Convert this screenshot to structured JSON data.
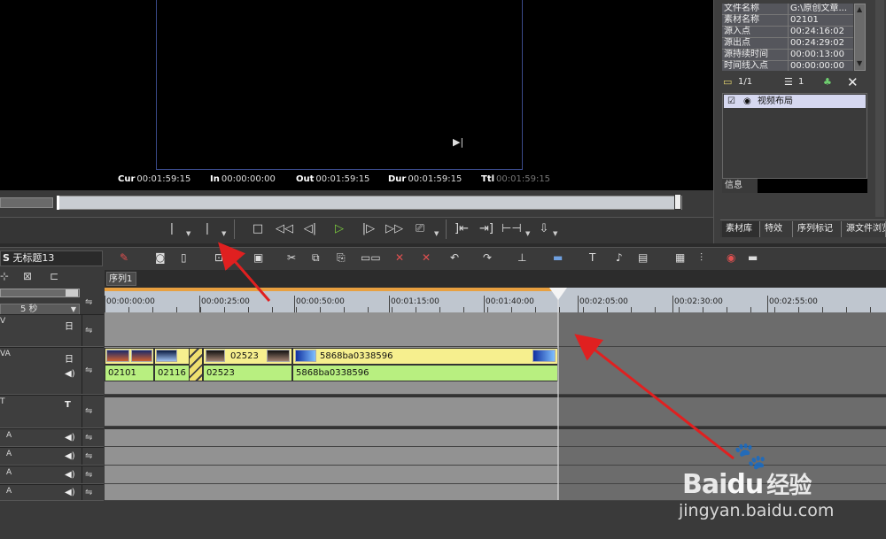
{
  "preview": {
    "timecodes": [
      {
        "label": "Cur",
        "value": "00:01:59:15"
      },
      {
        "label": "In",
        "value": "00:00:00:00"
      },
      {
        "label": "Out",
        "value": "00:01:59:15"
      },
      {
        "label": "Dur",
        "value": "00:01:59:15"
      },
      {
        "label": "Ttl",
        "value": "00:01:59:15"
      }
    ],
    "play_glyph": "▶|"
  },
  "transport_icons": [
    "mark-in-icon",
    "mark-out-icon",
    "stop-icon",
    "rewind-icon",
    "step-back-icon",
    "play-icon",
    "step-forward-icon",
    "fast-forward-icon",
    "loop-icon",
    "go-in-icon",
    "go-out-icon",
    "split-icon",
    "insert-icon"
  ],
  "properties": {
    "rows": [
      {
        "key": "文件名称",
        "value": "G:\\原创文章..."
      },
      {
        "key": "素材名称",
        "value": "02101"
      },
      {
        "key": "源入点",
        "value": "00:24:16:02"
      },
      {
        "key": "源出点",
        "value": "00:24:29:02"
      },
      {
        "key": "源持续时间",
        "value": "00:00:13:00"
      },
      {
        "key": "时间线入点",
        "value": "00:00:00:00"
      }
    ]
  },
  "right_panel": {
    "page": "1/1",
    "count": "1",
    "list_item": "视频布局",
    "info_tab": "信息",
    "tabs": [
      "素材库",
      "特效",
      "序列标记",
      "源文件浏览"
    ]
  },
  "timeline": {
    "project_name": "无标题13",
    "project_prefix": "S",
    "sequence_tab": "序列1",
    "zoom": "5 秒",
    "ruler_labels": [
      "00:00:00:00",
      "00:00:25:00",
      "00:00:50:00",
      "00:01:15:00",
      "00:01:40:00",
      "00:02:05:00",
      "00:02:30:00",
      "00:02:55:00"
    ],
    "tracks": [
      {
        "name": "V",
        "icon": "日"
      },
      {
        "name": "VA",
        "icon": "日",
        "icon2": "◀)"
      },
      {
        "name": "T",
        "icon": "T"
      },
      {
        "name": "A",
        "icon": "◀)"
      },
      {
        "name": "A",
        "icon": "◀)"
      },
      {
        "name": "A",
        "icon": "◀)"
      },
      {
        "name": "A",
        "icon": "◀)"
      }
    ],
    "clips_video": [
      "02523",
      "5868ba0338596"
    ],
    "clips_audio": [
      "02101",
      "02116",
      "02523",
      "5868ba0338596"
    ]
  },
  "watermark": {
    "brand": "Bai",
    "brand2": "du",
    "suffix": "经验",
    "url": "jingyan.baidu.com"
  }
}
